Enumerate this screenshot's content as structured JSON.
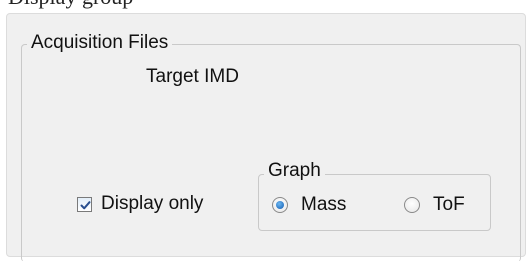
{
  "header_fragment": {
    "text": "Display group"
  },
  "acquisition_files": {
    "title": "Acquisition Files",
    "target_label": "Target IMD"
  },
  "display_only": {
    "label": "Display only",
    "checked": true
  },
  "graph": {
    "title": "Graph",
    "options": [
      {
        "label": "Mass",
        "selected": true
      },
      {
        "label": "ToF",
        "selected": false
      }
    ]
  },
  "colors": {
    "panel_background": "#f0f0f0",
    "groupbox_border": "#c9c9c9",
    "radio_selected": "#1a64b8",
    "check_mark": "#2a4f8f"
  },
  "icons": {
    "checkbox_mark": "checkmark-icon",
    "radio_dot": "radio-dot-icon"
  }
}
